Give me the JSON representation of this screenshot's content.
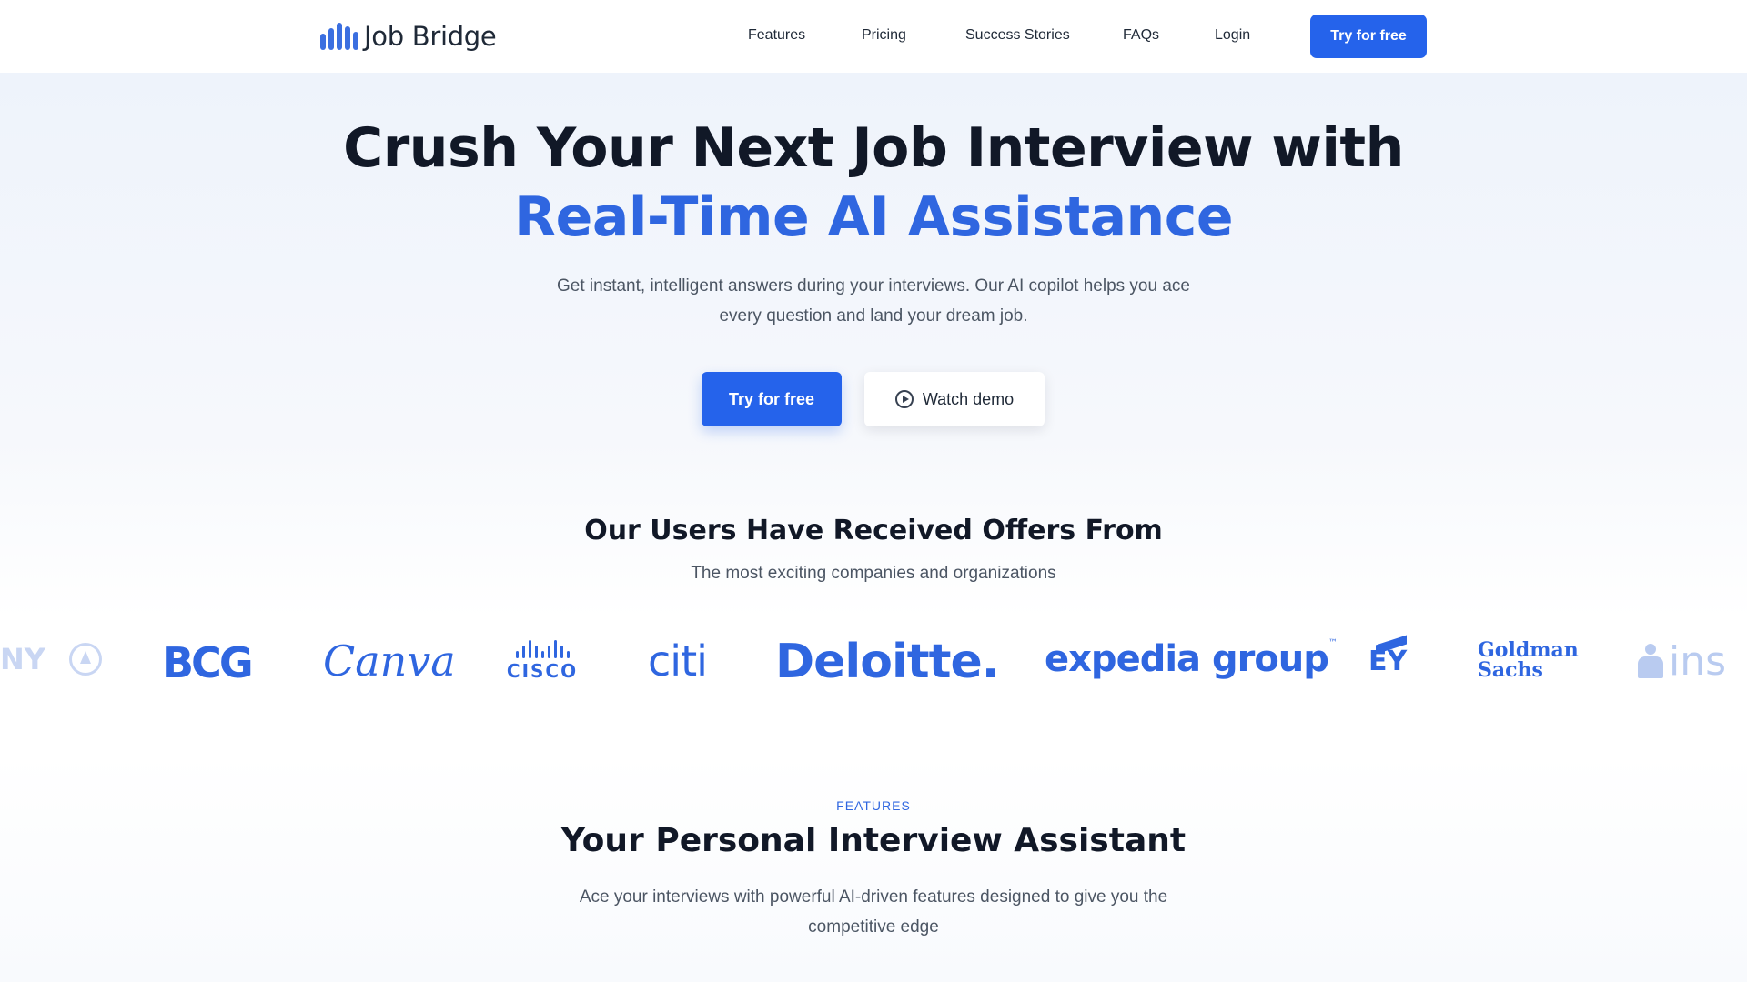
{
  "brand": {
    "name": "Job Bridge",
    "icon": "bars-logo-icon",
    "accent": "#2563eb"
  },
  "nav": {
    "links": [
      "Features",
      "Pricing",
      "Success Stories",
      "FAQs",
      "Login"
    ],
    "cta": "Try for free"
  },
  "hero": {
    "title_line1": "Crush Your Next Job Interview with",
    "title_line2": "Real-Time AI Assistance",
    "subtitle": "Get instant, intelligent answers during your interviews. Our AI copilot helps you ace every question and land your dream job.",
    "primary_cta": "Try for free",
    "secondary_cta": "Watch demo",
    "secondary_icon": "play-circle-icon"
  },
  "offers": {
    "title": "Our Users Have Received Offers From",
    "subtitle": "The most exciting companies and organizations",
    "logos": {
      "partial_left": "NY",
      "bcg": "BCG",
      "canva": "Canva",
      "cisco": "CISCO",
      "citi": "citi",
      "deloitte": "Deloitte.",
      "expedia": "expedia group",
      "expedia_tm": "™",
      "ey": "EY",
      "goldman_line1": "Goldman",
      "goldman_line2": "Sachs",
      "partial_right": "ins"
    }
  },
  "features": {
    "eyebrow": "FEATURES",
    "title": "Your Personal Interview Assistant",
    "subtitle": "Ace your interviews with powerful AI-driven features designed to give you the competitive edge"
  }
}
